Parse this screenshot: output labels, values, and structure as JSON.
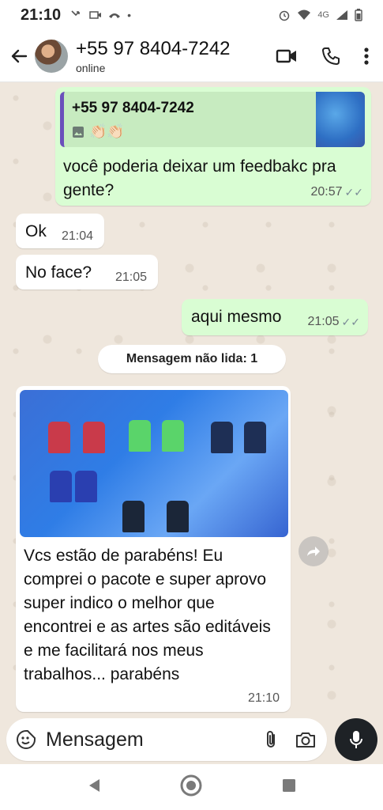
{
  "status_bar": {
    "time": "21:10",
    "network": "4G"
  },
  "header": {
    "contact_name": "+55 97 8404-7242",
    "status": "online"
  },
  "messages": {
    "m1": {
      "quote_name": "+55 97 8404-7242",
      "quote_emoji": "👏🏻👏🏻",
      "text": "você poderia deixar um feedbakc pra gente?",
      "time": "20:57"
    },
    "m2": {
      "text": "Ok",
      "time": "21:04"
    },
    "m3": {
      "text": "No face?",
      "time": "21:05"
    },
    "m4": {
      "text": "aqui mesmo",
      "time": "21:05"
    },
    "unread_divider": "Mensagem não lida: 1",
    "m5": {
      "text": "Vcs estão de parabéns! Eu comprei o pacote e super aprovo super indico o melhor que encontrei e as artes são editáveis e me facilitará nos meus trabalhos... parabéns",
      "time": "21:10"
    }
  },
  "input": {
    "placeholder": "Mensagem"
  },
  "colors": {
    "outgoing": "#d9fdd3",
    "incoming": "#ffffff",
    "quote_bar": "#6b4fbb",
    "mic": "#1e2226"
  }
}
